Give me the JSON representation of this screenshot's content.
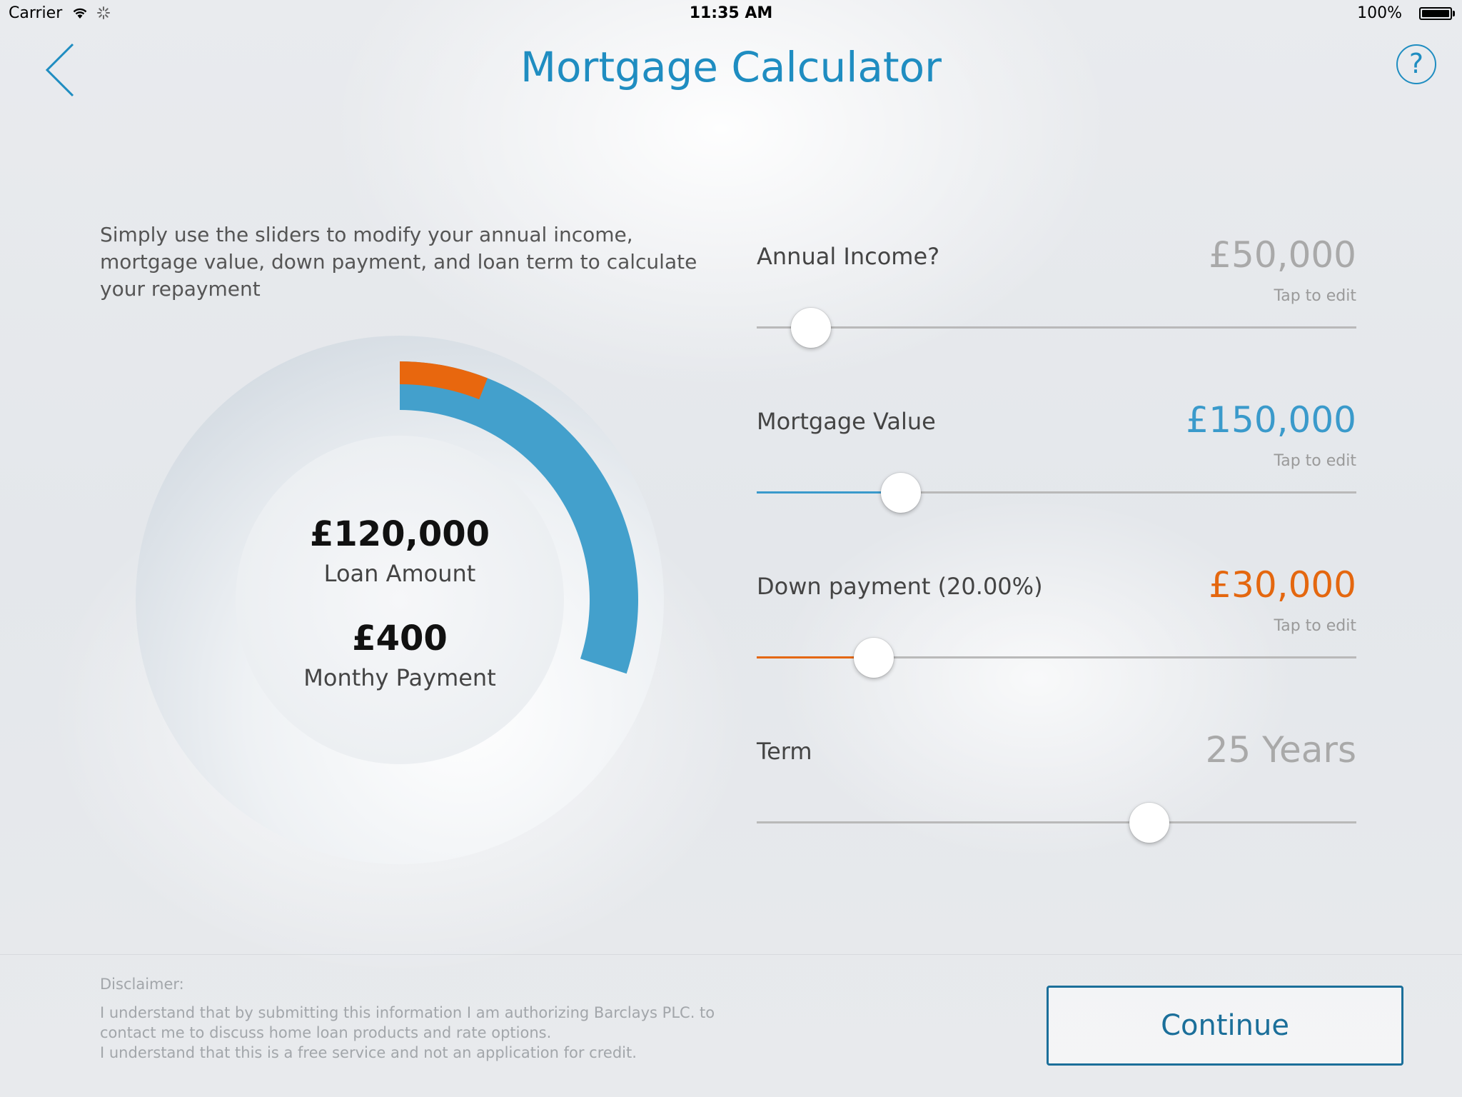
{
  "status_bar": {
    "carrier": "Carrier",
    "time": "11:35 AM",
    "battery": "100%"
  },
  "header": {
    "title": "Mortgage Calculator",
    "back_icon": "chevron-left-icon",
    "help_label": "?"
  },
  "intro": "Simply use the sliders to modify your annual income, mortgage value, down payment, and loan term to calculate your repayment",
  "donut": {
    "loan_value": "£120,000",
    "loan_label": "Loan Amount",
    "payment_value": "£400",
    "payment_label": "Monthy Payment",
    "mortgage_fraction": 0.3,
    "down_payment_fraction": 0.06,
    "colors": {
      "mortgage": "#43a0cc",
      "down_payment": "#e8670e",
      "ring": "#dde3e8"
    }
  },
  "sliders": [
    {
      "label": "Annual Income?",
      "value": "£50,000",
      "hint": "Tap to edit",
      "position": 0.09,
      "value_color": "#a9a9a9",
      "fill_color": ""
    },
    {
      "label": "Mortgage Value",
      "value": "£150,000",
      "hint": "Tap to edit",
      "position": 0.24,
      "value_color": "#3a9acb",
      "fill_color": "#3a9acb"
    },
    {
      "label": "Down payment (20.00%)",
      "value": "£30,000",
      "hint": "Tap to edit",
      "position": 0.195,
      "value_color": "#e4670f",
      "fill_color": "#e4670f"
    },
    {
      "label": "Term",
      "value": "25 Years",
      "hint": "",
      "position": 0.655,
      "value_color": "#a9a9a9",
      "fill_color": ""
    }
  ],
  "footer": {
    "disclaimer_title": "Disclaimer:",
    "disclaimer_lines": [
      "I understand that by submitting this information I am authorizing Barclays PLC. to",
      "contact me to discuss home loan products and rate options.",
      "I understand that this is a free service and not an application for credit."
    ],
    "continue_label": "Continue"
  }
}
